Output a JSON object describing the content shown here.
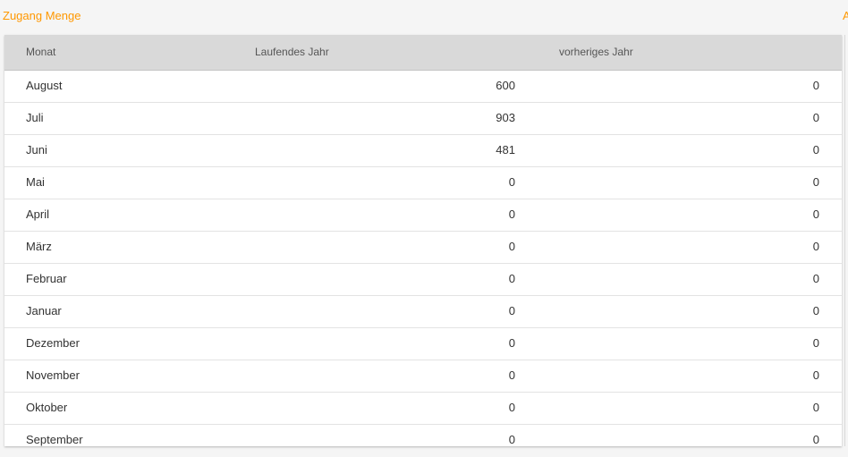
{
  "panel": {
    "title": "Zugang Menge",
    "next_title_fragment": "A"
  },
  "table": {
    "headers": {
      "month": "Monat",
      "current_year": "Laufendes Jahr",
      "previous_year": "vorheriges Jahr"
    },
    "rows": [
      {
        "month": "August",
        "current": "600",
        "previous": "0"
      },
      {
        "month": "Juli",
        "current": "903",
        "previous": "0"
      },
      {
        "month": "Juni",
        "current": "481",
        "previous": "0"
      },
      {
        "month": "Mai",
        "current": "0",
        "previous": "0"
      },
      {
        "month": "April",
        "current": "0",
        "previous": "0"
      },
      {
        "month": "März",
        "current": "0",
        "previous": "0"
      },
      {
        "month": "Februar",
        "current": "0",
        "previous": "0"
      },
      {
        "month": "Januar",
        "current": "0",
        "previous": "0"
      },
      {
        "month": "Dezember",
        "current": "0",
        "previous": "0"
      },
      {
        "month": "November",
        "current": "0",
        "previous": "0"
      },
      {
        "month": "Oktober",
        "current": "0",
        "previous": "0"
      },
      {
        "month": "September",
        "current": "0",
        "previous": "0"
      }
    ]
  },
  "colors": {
    "accent": "#ff9800",
    "header_bg": "#d9d9d9",
    "page_bg": "#f5f5f5"
  }
}
